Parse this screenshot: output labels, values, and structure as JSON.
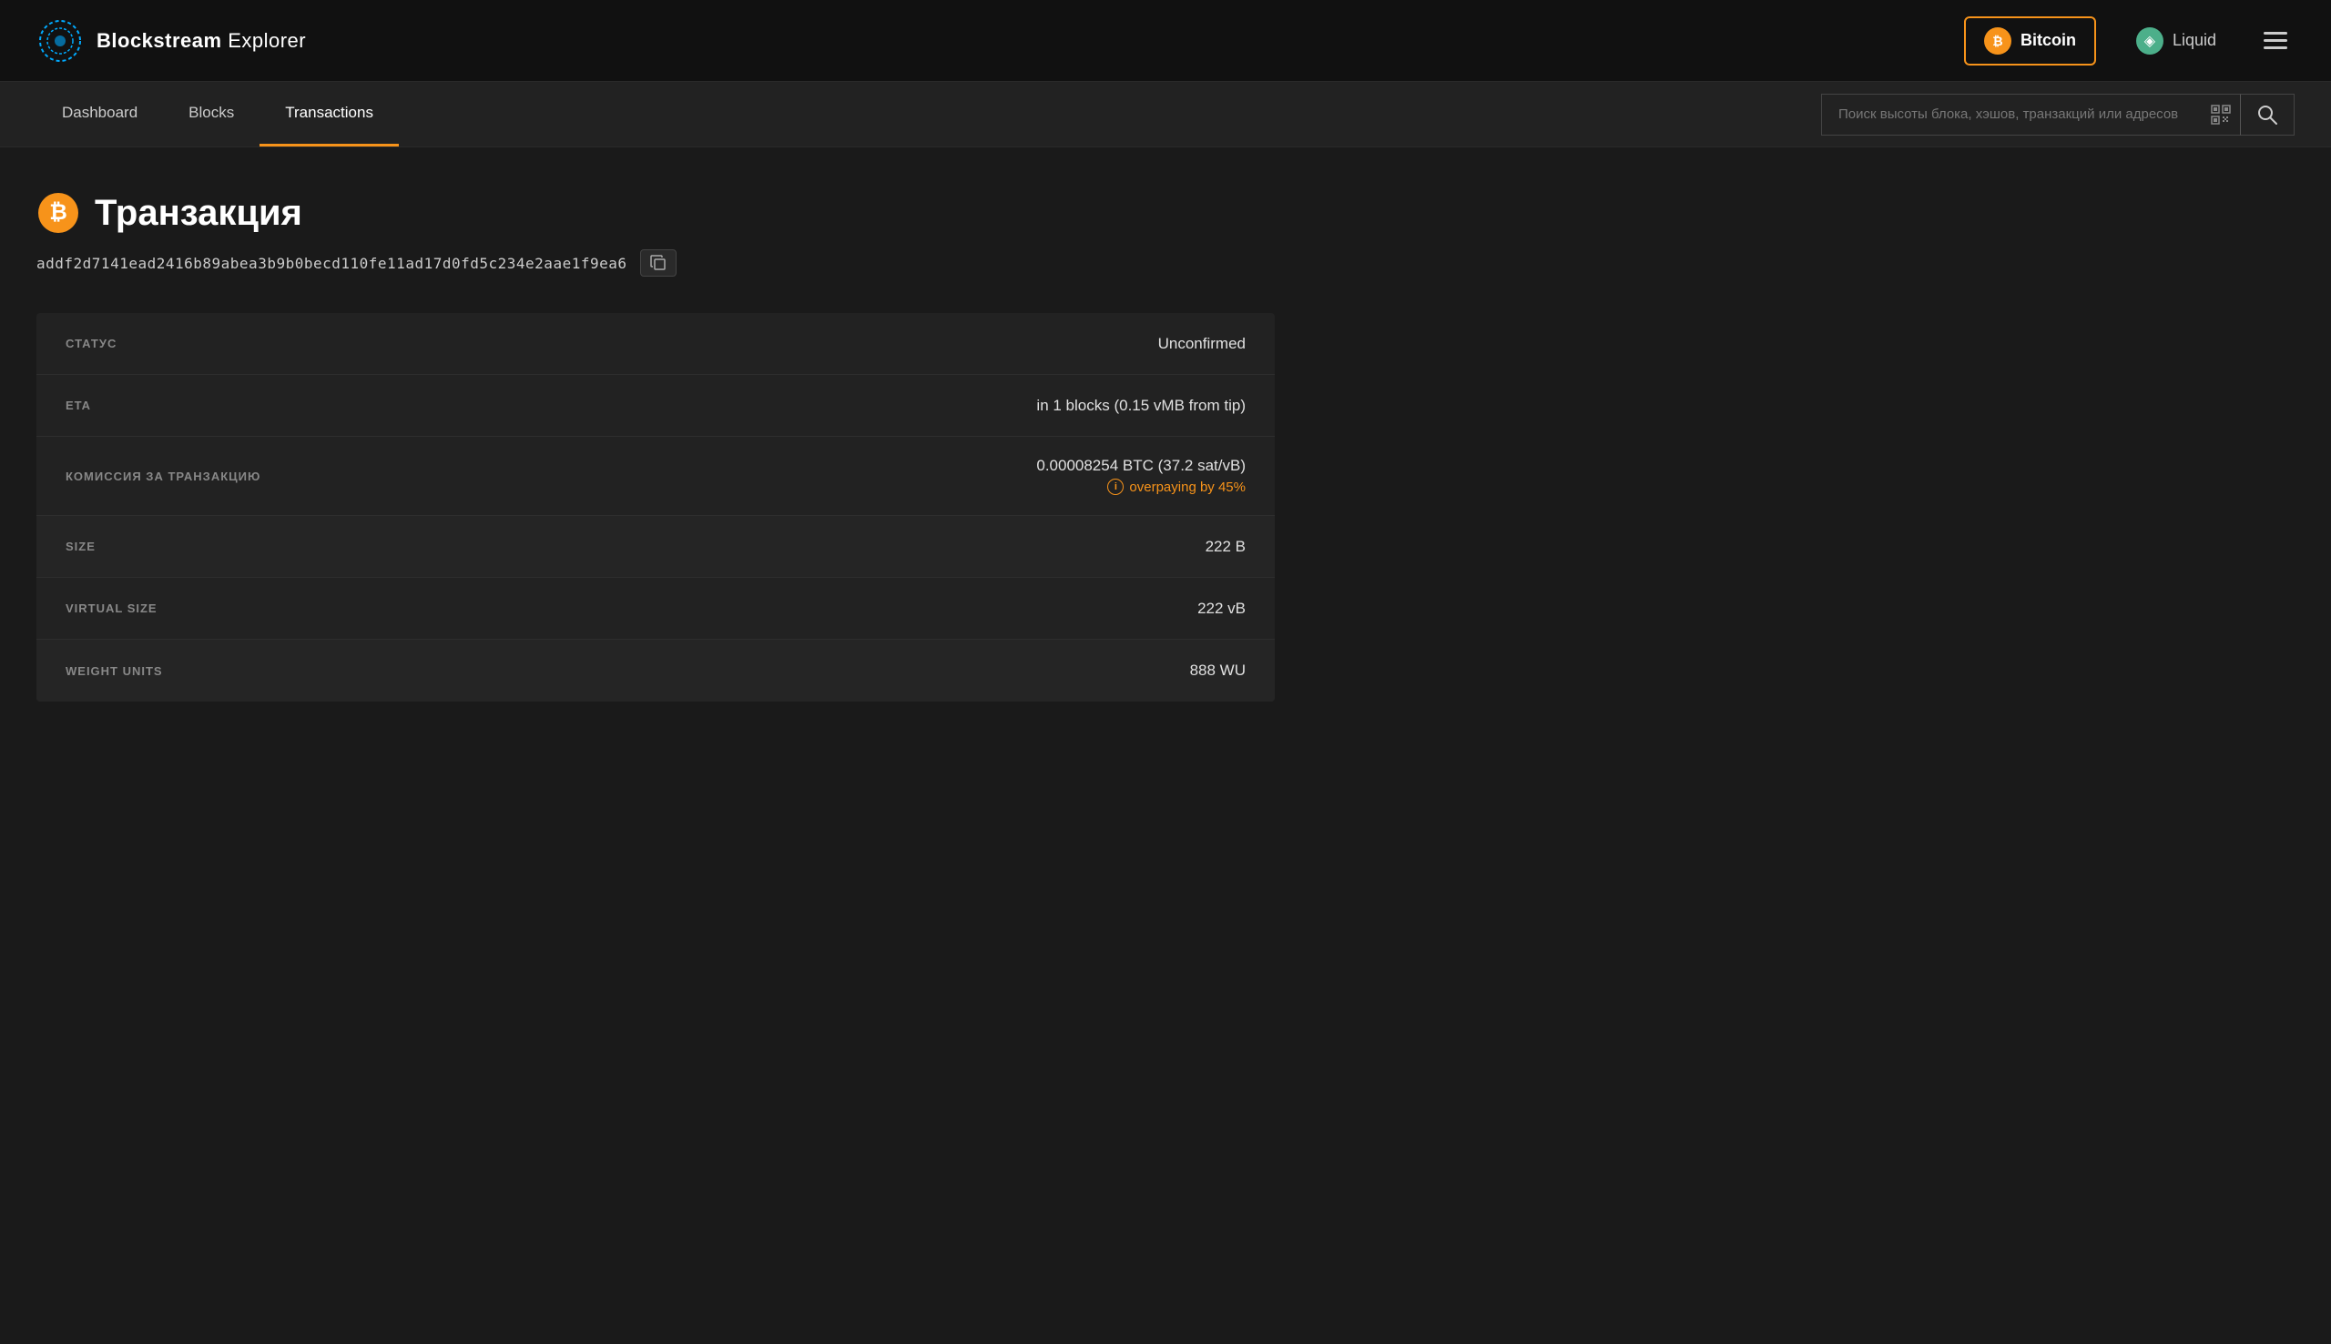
{
  "topNav": {
    "logoTextBold": "Blockstream",
    "logoTextLight": " Explorer",
    "bitcoinLabel": "Bitcoin",
    "liquidLabel": "Liquid"
  },
  "subNav": {
    "links": [
      {
        "id": "dashboard",
        "label": "Dashboard",
        "active": false
      },
      {
        "id": "blocks",
        "label": "Blocks",
        "active": false
      },
      {
        "id": "transactions",
        "label": "Transactions",
        "active": true
      }
    ],
    "searchPlaceholder": "Поиск высоты блока, хэшов, транзакций или адресов"
  },
  "page": {
    "title": "Транзакция",
    "txHash": "addf2d7141ead2416b89abea3b9b0becd110fe11ad17d0fd5c234e2aae1f9ea6"
  },
  "infoTable": {
    "rows": [
      {
        "id": "status",
        "label": "СТАТУС",
        "value": "Unconfirmed",
        "highlighted": false
      },
      {
        "id": "eta",
        "label": "ETA",
        "value": "in 1 blocks (0.15 vMB from tip)",
        "highlighted": false
      },
      {
        "id": "fee",
        "label": "КОМИССИЯ ЗА ТРАНЗАКЦИЮ",
        "value": "0.00008254 BTC (37.2 sat/vB)",
        "overpaying": "overpaying by 45%",
        "highlighted": false
      },
      {
        "id": "size",
        "label": "SIZE",
        "value": "222 B",
        "highlighted": true
      },
      {
        "id": "virtualSize",
        "label": "VIRTUAL SIZE",
        "value": "222 vB",
        "highlighted": false
      },
      {
        "id": "weightUnits",
        "label": "WEIGHT UNITS",
        "value": "888 WU",
        "highlighted": true
      }
    ]
  },
  "colors": {
    "accent": "#f7931a",
    "overpaying": "#f7931a",
    "background": "#1a1a1a",
    "navBg": "#111111",
    "subNavBg": "#222222",
    "tableBg": "#222222"
  }
}
